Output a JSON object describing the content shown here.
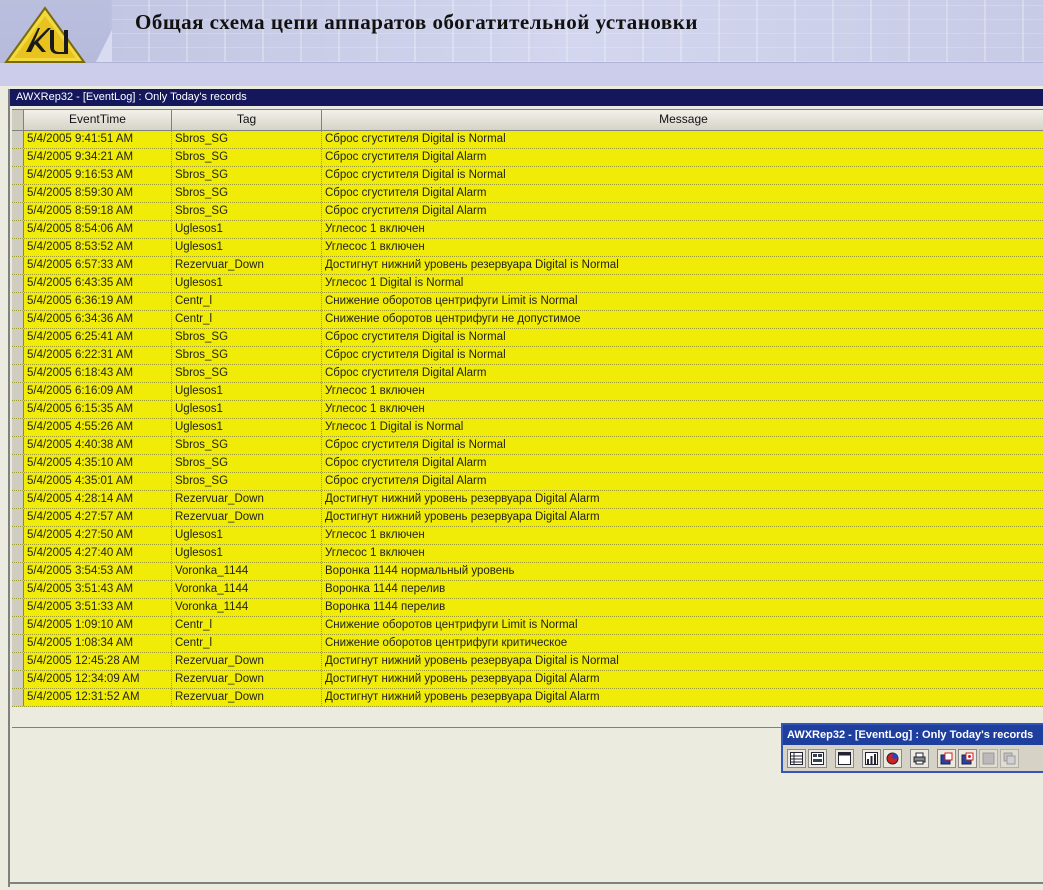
{
  "header": {
    "title": "Общая схема цепи аппаратов обогатительной установки",
    "logo_text": "KU"
  },
  "window": {
    "title": "AWXRep32 - [EventLog]  : Only Today's records"
  },
  "grid": {
    "columns": [
      "EventTime",
      "Tag",
      "Message"
    ],
    "rows": [
      [
        "5/4/2005 9:41:51 AM",
        "Sbros_SG",
        "Сброс сгустителя Digital is Normal"
      ],
      [
        "5/4/2005 9:34:21 AM",
        "Sbros_SG",
        "Сброс сгустителя Digital Alarm"
      ],
      [
        "5/4/2005 9:16:53 AM",
        "Sbros_SG",
        "Сброс сгустителя Digital is Normal"
      ],
      [
        "5/4/2005 8:59:30 AM",
        "Sbros_SG",
        "Сброс сгустителя Digital Alarm"
      ],
      [
        "5/4/2005 8:59:18 AM",
        "Sbros_SG",
        "Сброс сгустителя Digital Alarm"
      ],
      [
        "5/4/2005 8:54:06 AM",
        "Uglesos1",
        "Углесос 1  включен"
      ],
      [
        "5/4/2005 8:53:52 AM",
        "Uglesos1",
        "Углесос 1  включен"
      ],
      [
        "5/4/2005 6:57:33 AM",
        "Rezervuar_Down",
        "Достигнут нижний уровень резервуара Digital is Normal"
      ],
      [
        "5/4/2005 6:43:35 AM",
        "Uglesos1",
        "Углесос 1  Digital is Normal"
      ],
      [
        "5/4/2005 6:36:19 AM",
        "Centr_l",
        "Снижение оборотов центрифуги Limit is Normal"
      ],
      [
        "5/4/2005 6:34:36 AM",
        "Centr_l",
        "Снижение оборотов центрифуги не допустимое"
      ],
      [
        "5/4/2005 6:25:41 AM",
        "Sbros_SG",
        "Сброс сгустителя Digital is Normal"
      ],
      [
        "5/4/2005 6:22:31 AM",
        "Sbros_SG",
        "Сброс сгустителя Digital is Normal"
      ],
      [
        "5/4/2005 6:18:43 AM",
        "Sbros_SG",
        "Сброс сгустителя Digital Alarm"
      ],
      [
        "5/4/2005 6:16:09 AM",
        "Uglesos1",
        "Углесос 1  включен"
      ],
      [
        "5/4/2005 6:15:35 AM",
        "Uglesos1",
        "Углесос 1  включен"
      ],
      [
        "5/4/2005 4:55:26 AM",
        "Uglesos1",
        "Углесос 1  Digital is Normal"
      ],
      [
        "5/4/2005 4:40:38 AM",
        "Sbros_SG",
        "Сброс сгустителя Digital is Normal"
      ],
      [
        "5/4/2005 4:35:10 AM",
        "Sbros_SG",
        "Сброс сгустителя Digital Alarm"
      ],
      [
        "5/4/2005 4:35:01 AM",
        "Sbros_SG",
        "Сброс сгустителя Digital Alarm"
      ],
      [
        "5/4/2005 4:28:14 AM",
        "Rezervuar_Down",
        "Достигнут нижний уровень резервуара Digital Alarm"
      ],
      [
        "5/4/2005 4:27:57 AM",
        "Rezervuar_Down",
        "Достигнут нижний уровень резервуара Digital Alarm"
      ],
      [
        "5/4/2005 4:27:50 AM",
        "Uglesos1",
        "Углесос 1  включен"
      ],
      [
        "5/4/2005 4:27:40 AM",
        "Uglesos1",
        "Углесос 1  включен"
      ],
      [
        "5/4/2005 3:54:53 AM",
        "Voronka_1144",
        "Воронка 1144  нормальный уровень"
      ],
      [
        "5/4/2005 3:51:43 AM",
        "Voronka_1144",
        "Воронка 1144  перелив"
      ],
      [
        "5/4/2005 3:51:33 AM",
        "Voronka_1144",
        "Воронка 1144  перелив"
      ],
      [
        "5/4/2005 1:09:10 AM",
        "Centr_l",
        "Снижение оборотов центрифуги Limit is Normal"
      ],
      [
        "5/4/2005 1:08:34 AM",
        "Centr_l",
        "Снижение оборотов центрифуги критическое"
      ],
      [
        "5/4/2005 12:45:28 AM",
        "Rezervuar_Down",
        "Достигнут нижний уровень резервуара Digital is Normal"
      ],
      [
        "5/4/2005 12:34:09 AM",
        "Rezervuar_Down",
        "Достигнут нижний уровень резервуара Digital Alarm"
      ],
      [
        "5/4/2005 12:31:52 AM",
        "Rezervuar_Down",
        "Достигнут нижний уровень резервуара Digital Alarm"
      ]
    ]
  },
  "mini_toolbar": {
    "title": "AWXRep32 - [EventLog]  : Only Today's records",
    "tools": [
      "table-icon",
      "form-icon",
      "window-icon",
      "bar-chart-icon",
      "pie-chart-icon",
      "print-icon",
      "export-icon",
      "import-icon",
      "refresh-icon",
      "copy-icon"
    ]
  },
  "colors": {
    "row_bg": "#f1ec07",
    "window_title_bg": "#14175c",
    "mini_title_bg": "#1f3f9f",
    "header_bg": "#c5c8e6"
  }
}
